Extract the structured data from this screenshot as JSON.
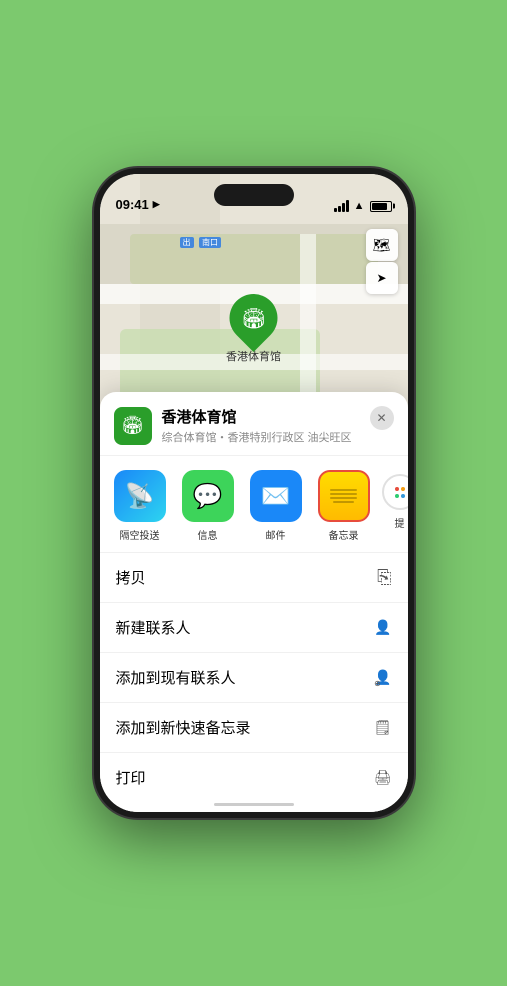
{
  "status_bar": {
    "time": "09:41",
    "location_arrow": "▲"
  },
  "map": {
    "label": "南口",
    "label_prefix": "出"
  },
  "venue": {
    "name": "香港体育馆",
    "description": "综合体育馆・香港特别行政区 油尖旺区",
    "pin_label": "香港体育馆"
  },
  "share_items": [
    {
      "id": "airdrop",
      "label": "隔空投送",
      "icon": "📡"
    },
    {
      "id": "message",
      "label": "信息",
      "icon": "💬"
    },
    {
      "id": "mail",
      "label": "邮件",
      "icon": "✉️"
    },
    {
      "id": "notes",
      "label": "备忘录",
      "icon": "notes"
    }
  ],
  "actions": [
    {
      "id": "copy",
      "label": "拷贝",
      "icon": "⎘"
    },
    {
      "id": "new-contact",
      "label": "新建联系人",
      "icon": "👤"
    },
    {
      "id": "add-existing",
      "label": "添加到现有联系人",
      "icon": "👤+"
    },
    {
      "id": "quick-note",
      "label": "添加到新快速备忘录",
      "icon": "🗒"
    },
    {
      "id": "print",
      "label": "打印",
      "icon": "🖨"
    }
  ],
  "close_label": "✕",
  "more_label": "提"
}
